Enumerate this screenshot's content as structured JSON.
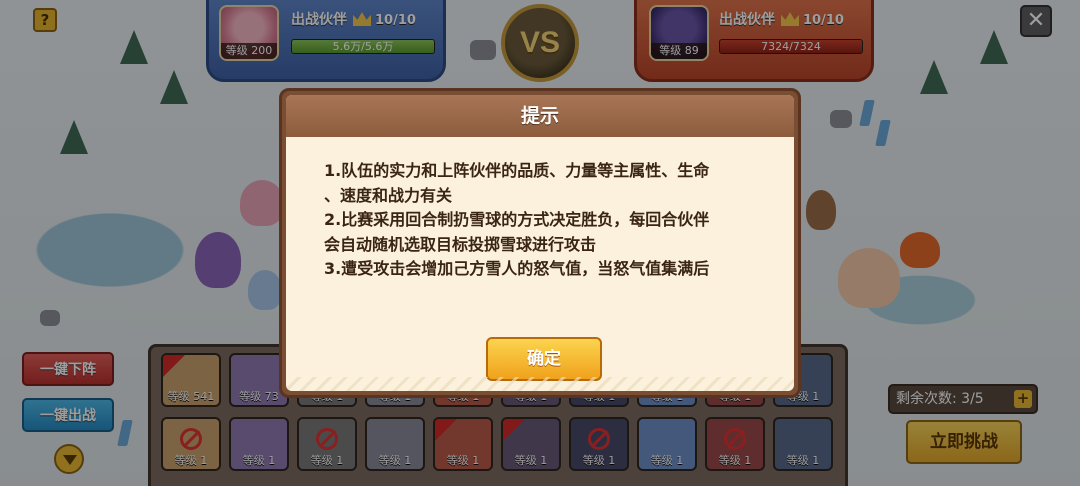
{
  "header": {
    "help_label": "?",
    "close_label": "✕",
    "vs_label": "VS"
  },
  "left_team": {
    "title": "出战伙伴",
    "count": "10/10",
    "level": "等级 200",
    "power": "5.6万/5.6万"
  },
  "right_team": {
    "title": "出战伙伴",
    "count": "10/10",
    "level": "等级 89",
    "power": "7324/7324"
  },
  "sidebar": {
    "remove_all_label": "一键下阵",
    "deploy_all_label": "一键出战"
  },
  "roster": {
    "slots": [
      {
        "level": "等级 541"
      },
      {
        "level": "等级 73"
      },
      {
        "level": "等级 1"
      },
      {
        "level": "等级 1"
      },
      {
        "level": "等级 1"
      },
      {
        "level": "等级 1"
      },
      {
        "level": "等级 1"
      },
      {
        "level": "等级 1"
      },
      {
        "level": "等级 1"
      },
      {
        "level": "等级 1"
      },
      {
        "level": "等级 1"
      },
      {
        "level": "等级 1"
      },
      {
        "level": "等级 1"
      },
      {
        "level": "等级 1"
      },
      {
        "level": "等级 1"
      },
      {
        "level": "等级 1"
      },
      {
        "level": "等级 1"
      },
      {
        "level": "等级 1"
      },
      {
        "level": "等级 1"
      },
      {
        "level": "等级 1"
      }
    ]
  },
  "remaining": {
    "label": "剩余次数:",
    "value": "3/5"
  },
  "challenge_label": "立即挑战",
  "dialog": {
    "title": "提示",
    "lines": [
      "1.队伍的实力和上阵伙伴的品质、力量等主属性、生命",
      "、速度和战力有关",
      "2.比赛采用回合制扔雪球的方式决定胜负，每回合伙伴",
      "会自动随机选取目标投掷雪球进行攻击",
      "3.遭受攻击会增加己方雪人的怒气值，当怒气值集满后"
    ],
    "confirm_label": "确定"
  },
  "colors": {
    "dialog_frame": "#7a4e32",
    "dialog_bg": "#fbf1dc",
    "confirm_button": "#f0a11c",
    "left_team": "#3f62a6",
    "right_team": "#b9452a"
  }
}
